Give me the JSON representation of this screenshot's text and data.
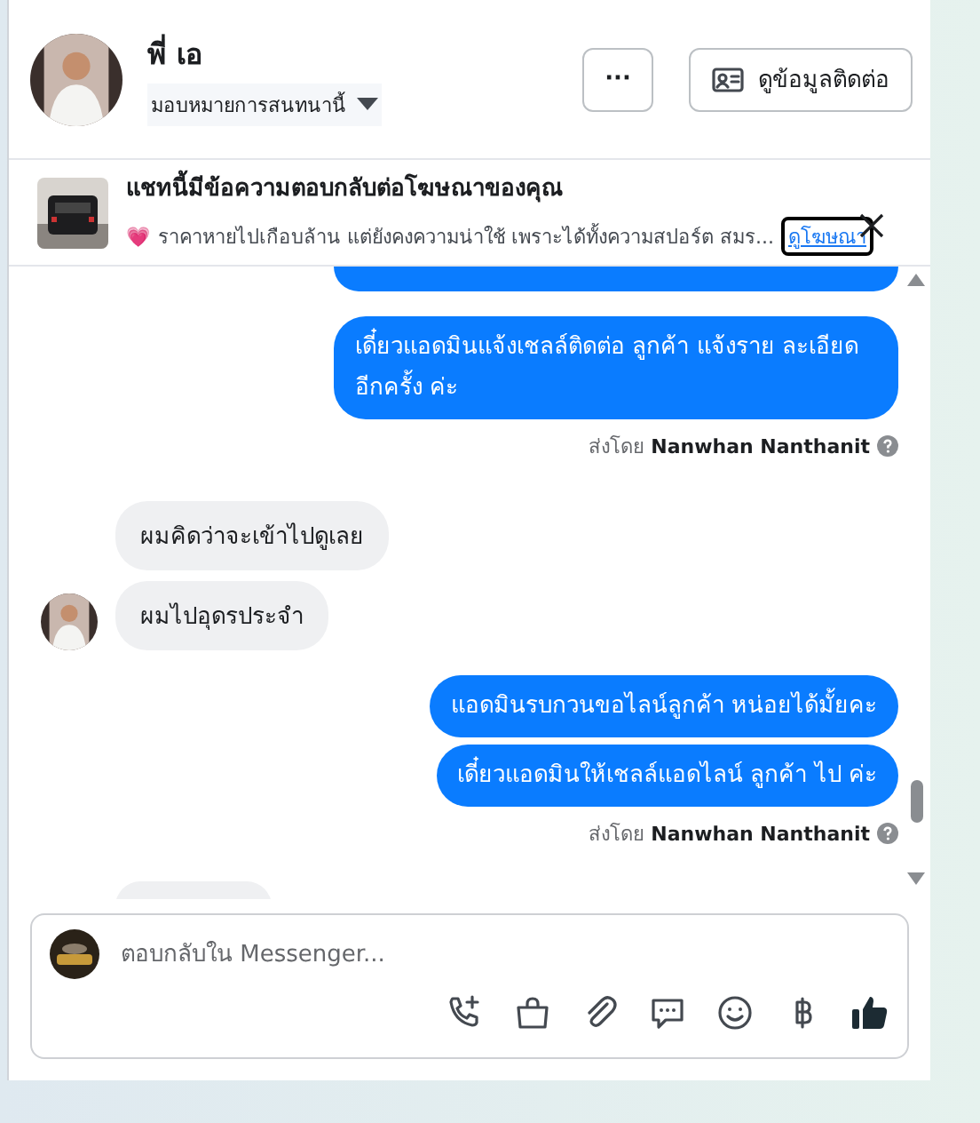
{
  "contact": {
    "name": "พี่ เอ",
    "assign_label": "มอบหมายการสนทนานี้",
    "more_button": "···",
    "contact_button": "ดูข้อมูลติดต่อ"
  },
  "ad_banner": {
    "title": "แชทนี้มีข้อความตอบกลับต่อโฆษณาของคุณ",
    "heart": "💗",
    "snippet": "ราคาหายไปเกือบล้าน แต่ยังคงความน่าใช้ เพราะได้ทั้งความสปอร์ต สมร...",
    "link": "ดูโฆษณา"
  },
  "messages": [
    {
      "kind": "cut-sent"
    },
    {
      "kind": "sent",
      "text": "เดี๋ยวแอดมินแจ้งเชลล์ติดต่อ ลูกค้า  แจ้งราย ละเอียดอีกครั้ง ค่ะ"
    },
    {
      "kind": "sender",
      "prefix": "ส่งโดย",
      "name": "Nanwhan Nanthanit"
    },
    {
      "kind": "received",
      "text": "ผมคิดว่าจะเข้าไปดูเลย",
      "avatar": false
    },
    {
      "kind": "received",
      "text": "ผมไปอุดรประจำ",
      "avatar": true
    },
    {
      "kind": "sent",
      "text": "แอดมินรบกวนขอไลน์ลูกค้า หน่อยได้มั้ยคะ"
    },
    {
      "kind": "sent",
      "text": "เดี๋ยวแอดมินให้เชลล์แอดไลน์ ลูกค้า ไป ค่ะ"
    },
    {
      "kind": "sender",
      "prefix": "ส่งโดย",
      "name": "Nanwhan Nanthanit"
    },
    {
      "kind": "cut-received"
    }
  ],
  "composer": {
    "placeholder": "ตอบกลับใน Messenger..."
  }
}
